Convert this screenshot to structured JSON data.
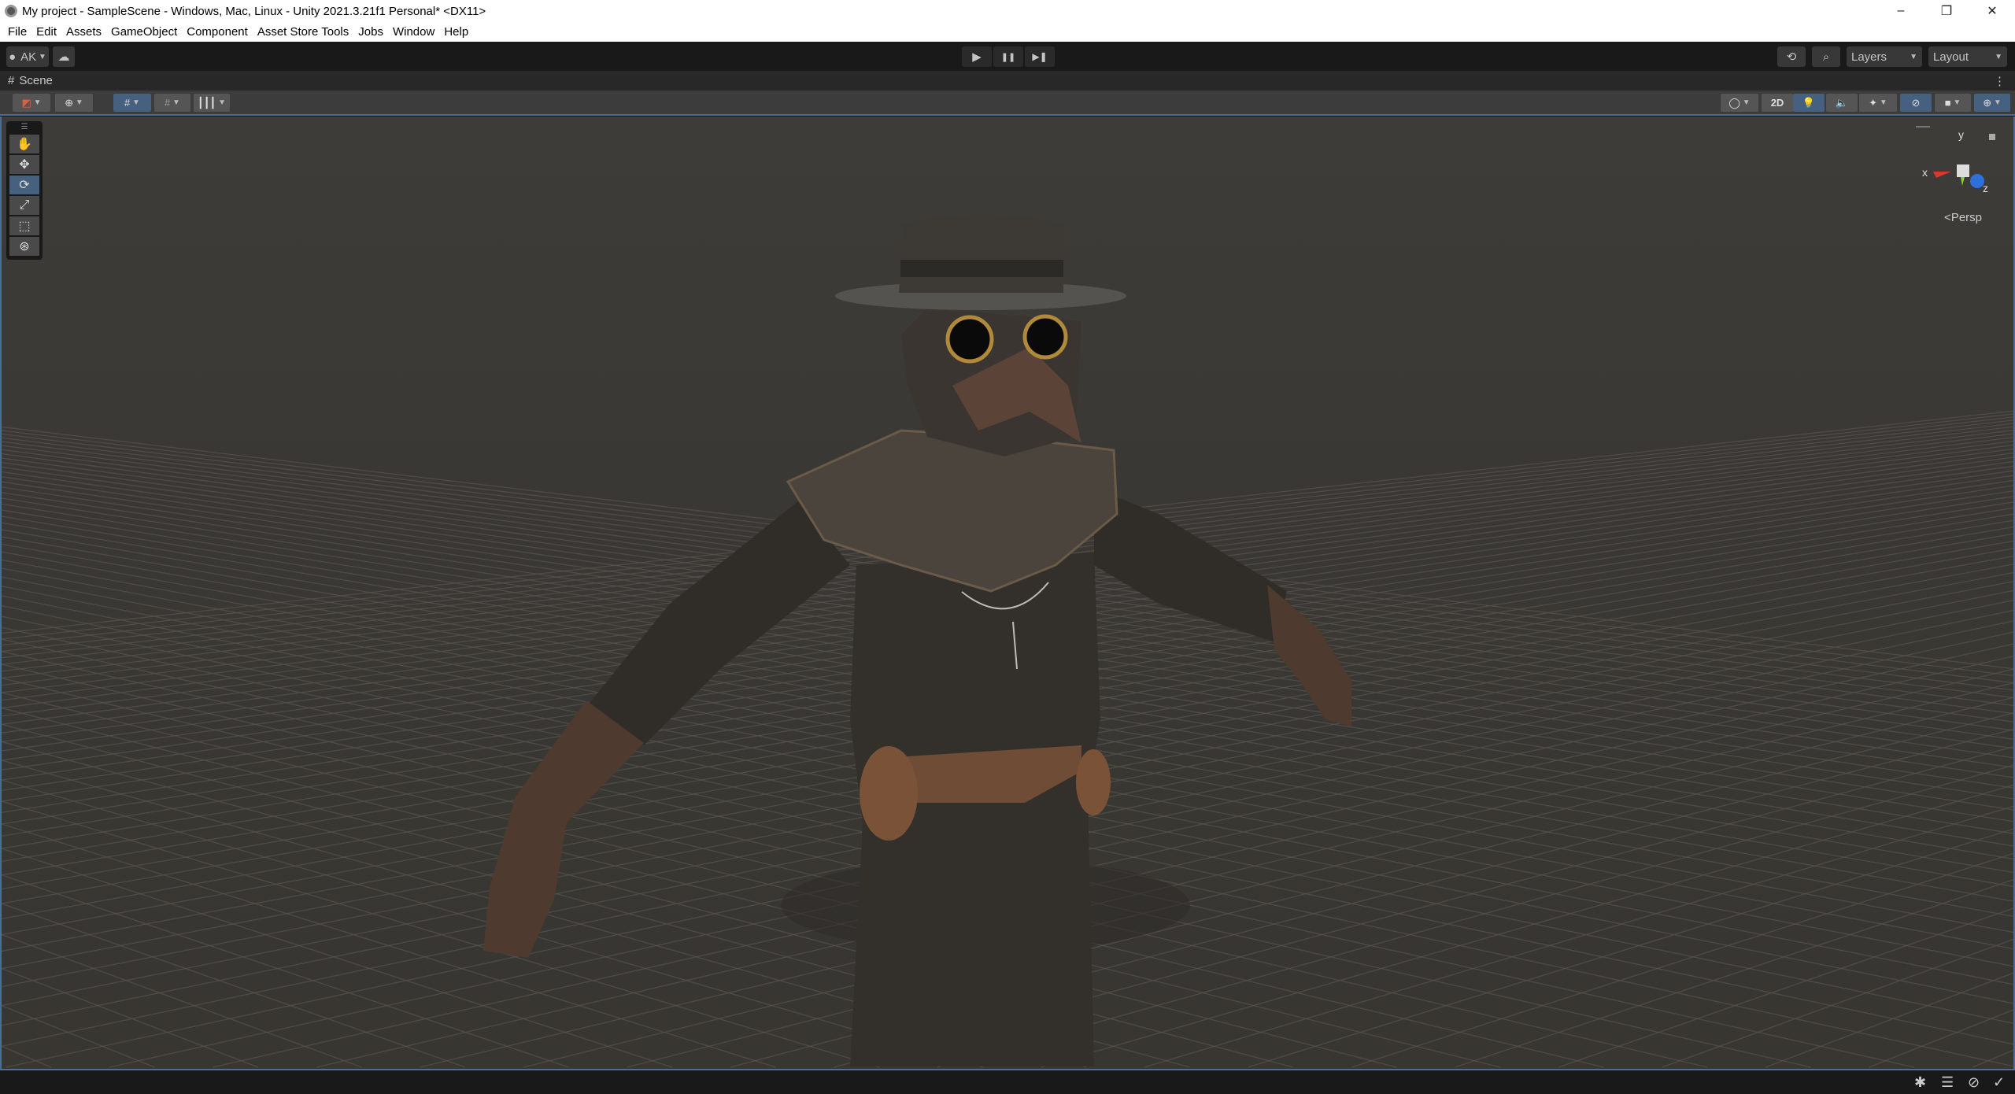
{
  "window": {
    "title": "My project - SampleScene - Windows, Mac, Linux - Unity 2021.3.21f1 Personal* <DX11>",
    "controls": [
      "–",
      "❐",
      "✕"
    ]
  },
  "menu": [
    "File",
    "Edit",
    "Assets",
    "GameObject",
    "Component",
    "Asset Store Tools",
    "Jobs",
    "Window",
    "Help"
  ],
  "toolbar": {
    "account": "AK",
    "layers": "Layers",
    "layout": "Layout",
    "play_icon": "▶",
    "pause_icon": "❚❚",
    "step_icon": "▶❚"
  },
  "scene": {
    "tab_label": "Scene",
    "toggle_2d": "2D",
    "view_mode": "Persp",
    "axis_x": "x",
    "axis_y": "y",
    "axis_z": "z"
  },
  "colors": {
    "accent": "#46607f",
    "axis_x": "#d8392a",
    "axis_y": "#8ad13a",
    "axis_z": "#2f6fdb"
  }
}
